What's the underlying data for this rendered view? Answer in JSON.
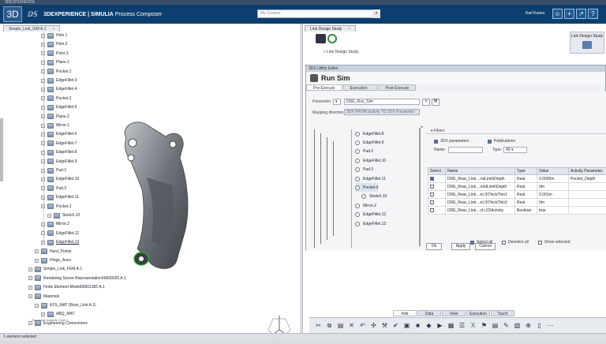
{
  "window": {
    "title": "3DEXPERIENCE"
  },
  "topbar": {
    "brand": "3D",
    "brand_text": "3DEXPERIENCE | SIMULIA",
    "app_name": "Process Composer",
    "search_placeholder": "My Content",
    "user": "Karl Kunes"
  },
  "left": {
    "tab_label": "Simple_Link_SIM A.1",
    "tree": [
      {
        "label": "Hole.1",
        "indent": 2
      },
      {
        "label": "Hole.2",
        "indent": 2
      },
      {
        "label": "Point.3",
        "indent": 2
      },
      {
        "label": "Plane.1",
        "indent": 2
      },
      {
        "label": "Pocket.1",
        "indent": 2
      },
      {
        "label": "EdgeFillet.3",
        "indent": 2
      },
      {
        "label": "EdgeFillet.4",
        "indent": 2
      },
      {
        "label": "Pocket.2",
        "indent": 2
      },
      {
        "label": "EdgeFillet.5",
        "indent": 2
      },
      {
        "label": "Plane.2",
        "indent": 2
      },
      {
        "label": "Mirror.1",
        "indent": 2
      },
      {
        "label": "EdgeFillet.6",
        "indent": 2
      },
      {
        "label": "EdgeFillet.7",
        "indent": 2
      },
      {
        "label": "EdgeFillet.8",
        "indent": 2
      },
      {
        "label": "EdgeFillet.9",
        "indent": 2
      },
      {
        "label": "Pad.2",
        "indent": 2
      },
      {
        "label": "EdgeFillet.10",
        "indent": 2
      },
      {
        "label": "Pad.3",
        "indent": 2
      },
      {
        "label": "EdgeFillet.11",
        "indent": 2
      },
      {
        "label": "Pocket.3",
        "indent": 2
      },
      {
        "label": "Sketch.10",
        "indent": 3
      },
      {
        "label": "Mirror.2",
        "indent": 2
      },
      {
        "label": "EdgeFillet.12",
        "indent": 2
      },
      {
        "label": "EdgeFillet.13",
        "indent": 2,
        "selected": true
      },
      {
        "label": "Hard_Points",
        "indent": 1
      },
      {
        "label": "Hinge_Axes",
        "indent": 1
      },
      {
        "label": "Simple_Link_FEM A.1",
        "indent": 0
      },
      {
        "label": "Rendering Scene Representation00000025 A.1",
        "indent": 0
      },
      {
        "label": "Finite Element Model00001382 A.1",
        "indent": 0
      },
      {
        "label": "Materials",
        "indent": 0
      },
      {
        "label": "KFS_MAT (Rear_Link A.1)",
        "indent": 1
      },
      {
        "label": "ABQ_MAT",
        "indent": 2
      },
      {
        "label": "Engineering Connections",
        "indent": 0
      }
    ],
    "footer_hint": "Structural Analysis Case 1"
  },
  "right": {
    "tab_label": "Link Design Study",
    "tree_root": "Link Design Study",
    "side_panel_label": "Link Design Study"
  },
  "dialog": {
    "window_title": "3DX Utility Editor",
    "title": "Run Sim",
    "tabs": [
      "Pre-Execute",
      "Execution",
      "Post-Execute"
    ],
    "parameter_label": "Parameter",
    "parameter_value": "DDE_Run_Sim",
    "mapping_label": "Mapping direction:",
    "mapping_value": "3DX FROM activity TO 3DX Parameter",
    "map_nodes": [
      "EdgeFillet.8",
      "EdgeFillet.9",
      "Pad.2",
      "EdgeFillet.10",
      "Pad.3",
      "EdgeFillet.11",
      "Pocket.3",
      "Sketch.10",
      "Mirror.2",
      "EdgeFillet.12",
      "EdgeFillet.13"
    ],
    "filters_title": "Filters",
    "filter_3dx": "3DX parameters",
    "filter_pub": "Publications",
    "name_label": "Name:",
    "type_label": "Type:",
    "type_value": "All",
    "table": {
      "headers": [
        "Select",
        "Name",
        "Type",
        "Value",
        "Activity Parameter"
      ],
      "rows": [
        {
          "checked": true,
          "name": "DDE_Rear_Link....rstLimit\\Depth",
          "type": "Real",
          "value": "0.0035m",
          "activity": "Pocket_Depth"
        },
        {
          "checked": false,
          "name": "DDE_Rear_Link....ondLimit\\Depth",
          "type": "Real",
          "value": "0m",
          "activity": ""
        },
        {
          "checked": false,
          "name": "DDE_Rear_Link....et.3\\ThickThin1",
          "type": "Real",
          "value": "0.001m",
          "activity": ""
        },
        {
          "checked": false,
          "name": "DDE_Rear_Link....et.3\\ThickThin2",
          "type": "Real",
          "value": "0m",
          "activity": ""
        },
        {
          "checked": false,
          "name": "DDE_Rear_Link....ch.10\\Activity",
          "type": "Boolean",
          "value": "true",
          "activity": ""
        }
      ]
    },
    "select_all": "Select all",
    "deselect_all": "Deselect all",
    "show_selected": "Show selected",
    "ok": "Ok",
    "apply": "Apply",
    "cancel": "Cancel"
  },
  "bottom_tabs": [
    "Add",
    "Data",
    "View",
    "Execution",
    "Touch"
  ],
  "status": "1 element selected"
}
